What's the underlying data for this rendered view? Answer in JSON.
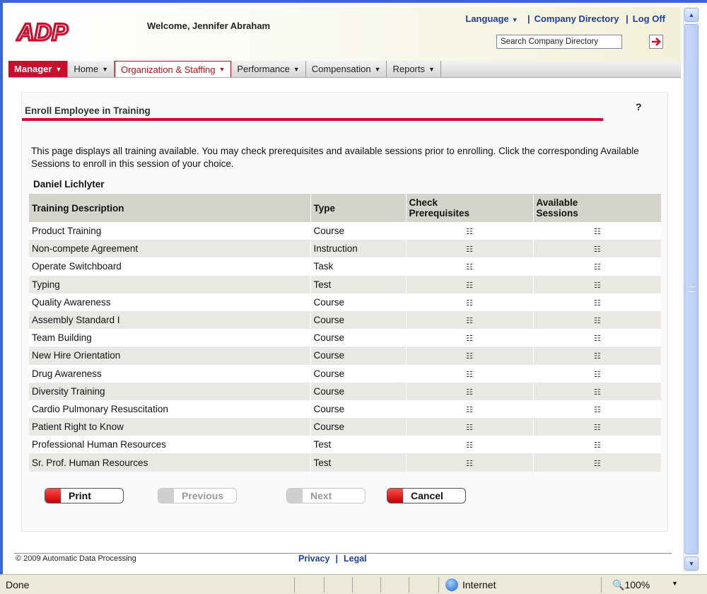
{
  "header": {
    "logo_text": "ADP",
    "welcome": "Welcome, Jennifer Abraham",
    "links": {
      "language": "Language",
      "directory": "Company Directory",
      "logoff": "Log Off"
    },
    "search": {
      "value": "Search Company Directory"
    }
  },
  "nav": {
    "items": [
      {
        "label": "Manager"
      },
      {
        "label": "Home"
      },
      {
        "label": "Organization & Staffing"
      },
      {
        "label": "Performance"
      },
      {
        "label": "Compensation"
      },
      {
        "label": "Reports"
      }
    ]
  },
  "page": {
    "title": "Enroll Employee in Training",
    "help": "?",
    "intro": "This page displays all training available. You may check prerequisites and available sessions prior to enrolling. Click the corresponding Available Sessions to enroll in this session of your choice.",
    "employee": "Daniel Lichlyter"
  },
  "table": {
    "headers": {
      "description": "Training Description",
      "type": "Type",
      "prereq": "Check Prerequisites",
      "sessions": "Available Sessions"
    },
    "icon_glyph": "☷",
    "rows": [
      {
        "description": "Product Training",
        "type": "Course"
      },
      {
        "description": "Non-compete Agreement",
        "type": "Instruction"
      },
      {
        "description": "Operate Switchboard",
        "type": "Task"
      },
      {
        "description": "Typing",
        "type": "Test"
      },
      {
        "description": "Quality Awareness",
        "type": "Course"
      },
      {
        "description": "Assembly Standard I",
        "type": "Course"
      },
      {
        "description": "Team Building",
        "type": "Course"
      },
      {
        "description": "New Hire Orientation",
        "type": "Course"
      },
      {
        "description": "Drug Awareness",
        "type": "Course"
      },
      {
        "description": "Diversity Training",
        "type": "Course"
      },
      {
        "description": "Cardio Pulmonary Resuscitation",
        "type": "Course"
      },
      {
        "description": "Patient Right to Know",
        "type": "Course"
      },
      {
        "description": "Professional Human Resources",
        "type": "Test"
      },
      {
        "description": "Sr. Prof. Human Resources",
        "type": "Test"
      }
    ]
  },
  "buttons": {
    "print": "Print",
    "previous": "Previous",
    "next": "Next",
    "cancel": "Cancel"
  },
  "footer": {
    "copyright": "© 2009 Automatic Data Processing",
    "privacy": "Privacy",
    "separator": "|",
    "legal": "Legal"
  },
  "statusbar": {
    "status": "Done",
    "zone": "Internet",
    "zoom": "100%"
  },
  "icons": [
    "logo",
    "arrow-right-icon",
    "chevron-down-icon",
    "help-icon",
    "document-icon",
    "globe-icon",
    "zoom-icon"
  ],
  "colors": {
    "brand_red": "#c8102e",
    "link_blue": "#1f3f9e",
    "header_row": "#d4d3cc",
    "alt_row": "#e9e8e4"
  }
}
